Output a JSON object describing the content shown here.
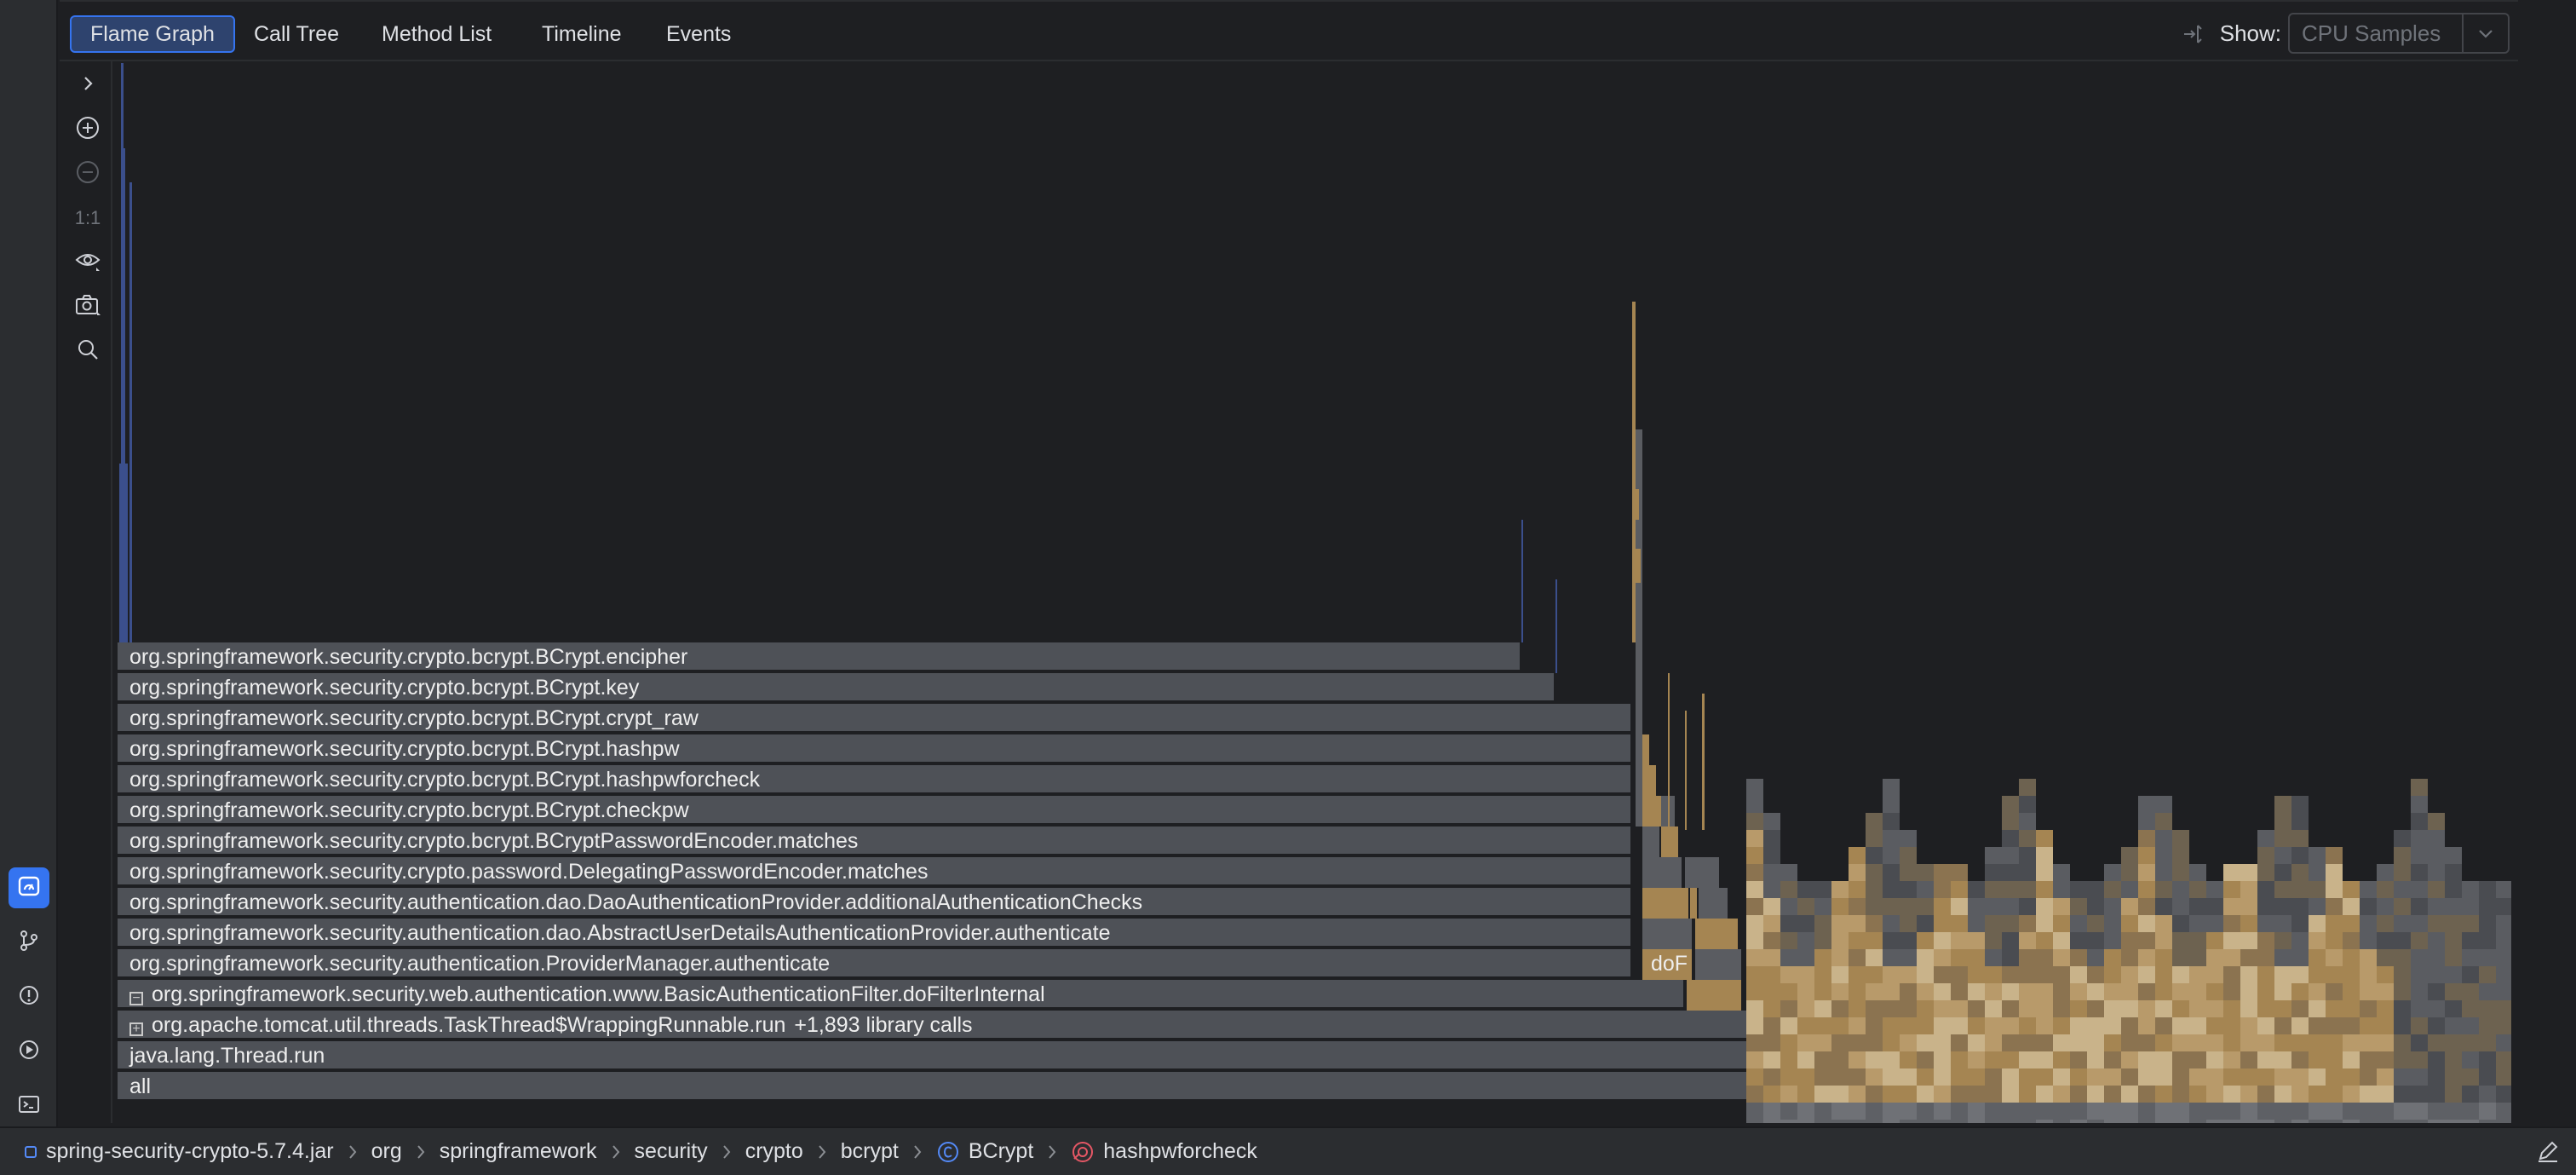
{
  "tabs": [
    {
      "label": "Flame Graph",
      "selected": true
    },
    {
      "label": "Call Tree",
      "selected": false
    },
    {
      "label": "Method List",
      "selected": false
    },
    {
      "label": "Timeline",
      "selected": false
    },
    {
      "label": "Events",
      "selected": false
    }
  ],
  "show": {
    "label": "Show:",
    "value": "CPU Samples"
  },
  "toolbar": {
    "one_to_one": "1:1",
    "icons": [
      "chevron-right-icon",
      "zoom-in-icon",
      "zoom-out-icon",
      "actual-size",
      "eye-icon",
      "camera-icon",
      "search-icon"
    ]
  },
  "frames": [
    {
      "label": "org.springframework.security.crypto.bcrypt.BCrypt.encipher"
    },
    {
      "label": "org.springframework.security.crypto.bcrypt.BCrypt.key"
    },
    {
      "label": "org.springframework.security.crypto.bcrypt.BCrypt.crypt_raw"
    },
    {
      "label": "org.springframework.security.crypto.bcrypt.BCrypt.hashpw"
    },
    {
      "label": "org.springframework.security.crypto.bcrypt.BCrypt.hashpwforcheck"
    },
    {
      "label": "org.springframework.security.crypto.bcrypt.BCrypt.checkpw"
    },
    {
      "label": "org.springframework.security.crypto.bcrypt.BCryptPasswordEncoder.matches"
    },
    {
      "label": "org.springframework.security.crypto.password.DelegatingPasswordEncoder.matches"
    },
    {
      "label": "org.springframework.security.authentication.dao.DaoAuthenticationProvider.additionalAuthenticationChecks"
    },
    {
      "label": "org.springframework.security.authentication.dao.AbstractUserDetailsAuthenticationProvider.authenticate"
    },
    {
      "label": "org.springframework.security.authentication.ProviderManager.authenticate"
    },
    {
      "label": "org.springframework.security.web.authentication.www.BasicAuthenticationFilter.doFilterInternal",
      "expander": "collapse"
    },
    {
      "label": "org.apache.tomcat.util.threads.TaskThread$WrappingRunnable.run",
      "expander": "expand",
      "suffix": "+1,893 library calls"
    },
    {
      "label": "java.lang.Thread.run"
    },
    {
      "label": "all"
    }
  ],
  "small_frame_label": "doF",
  "breadcrumbs": [
    {
      "label": "spring-security-crypto-5.7.4.jar",
      "icon": "module-icon"
    },
    {
      "label": "org"
    },
    {
      "label": "springframework"
    },
    {
      "label": "security"
    },
    {
      "label": "crypto"
    },
    {
      "label": "bcrypt"
    },
    {
      "label": "BCrypt",
      "icon": "class-icon"
    },
    {
      "label": "hashpwforcheck",
      "icon": "method-recursion-icon"
    }
  ],
  "colors": {
    "frame_gray": "#4e5157",
    "frame_gold": "#a58552",
    "frame_blue": "#3b4f8c",
    "accent": "#3574f0"
  }
}
